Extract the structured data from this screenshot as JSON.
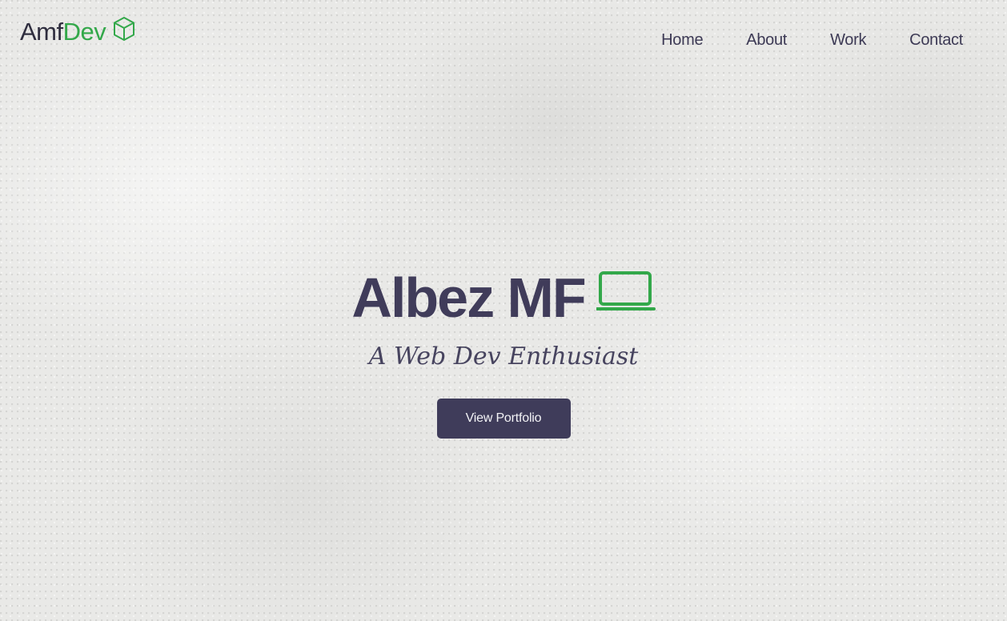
{
  "brand": {
    "logo_primary": "Amf",
    "logo_accent": "Dev",
    "logo_icon": "cube-icon",
    "accent_color": "#33a84a",
    "text_color": "#2f2e3f"
  },
  "nav": {
    "items": [
      {
        "label": "Home"
      },
      {
        "label": "About"
      },
      {
        "label": "Work"
      },
      {
        "label": "Contact"
      }
    ],
    "color": "#3d3a55"
  },
  "hero": {
    "title": "Albez MF",
    "title_icon": "laptop-icon",
    "subtitle": "A Web Dev Enthusiast",
    "cta_label": "View Portfolio",
    "cta_color": "#3f3c5a"
  }
}
